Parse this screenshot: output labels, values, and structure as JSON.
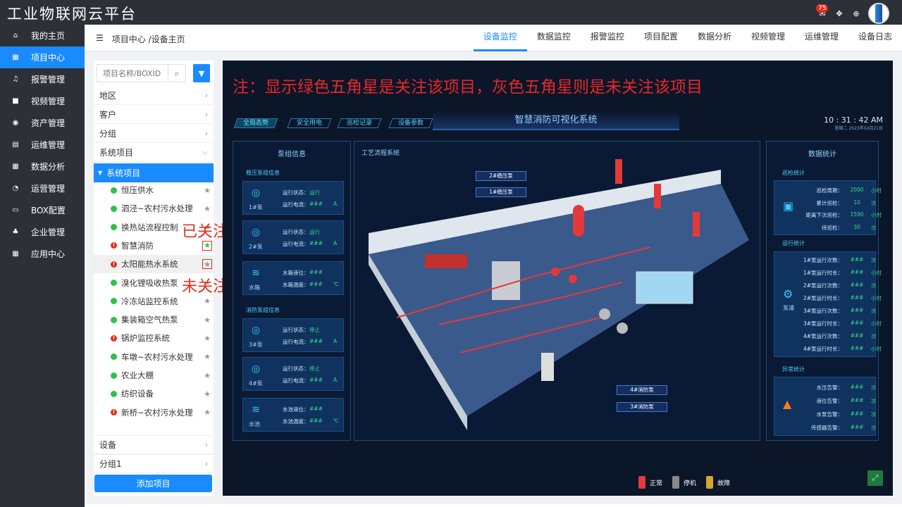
{
  "app": {
    "title": "工业物联网云平台",
    "badge": "75"
  },
  "sidebar": {
    "items": [
      {
        "label": "我的主页",
        "icon": "home-icon",
        "glyph": "⌂"
      },
      {
        "label": "项目中心",
        "icon": "grid-icon",
        "glyph": "▦"
      },
      {
        "label": "报警管理",
        "icon": "bell-icon",
        "glyph": "♫"
      },
      {
        "label": "视频管理",
        "icon": "video-icon",
        "glyph": "■"
      },
      {
        "label": "资产管理",
        "icon": "camera-icon",
        "glyph": "◉"
      },
      {
        "label": "运维管理",
        "icon": "clipboard-icon",
        "glyph": "▤"
      },
      {
        "label": "数据分析",
        "icon": "grid-icon",
        "glyph": "▦"
      },
      {
        "label": "运营管理",
        "icon": "pie-icon",
        "glyph": "◔"
      },
      {
        "label": "BOX配置",
        "icon": "monitor-icon",
        "glyph": "▭"
      },
      {
        "label": "企业管理",
        "icon": "org-icon",
        "glyph": "♣"
      },
      {
        "label": "应用中心",
        "icon": "grid-icon",
        "glyph": "▦"
      }
    ]
  },
  "header": {
    "breadcrumb": "项目中心 /设备主页",
    "tabs": [
      "设备监控",
      "数据监控",
      "报警监控",
      "项目配置",
      "数据分析",
      "视频管理",
      "运维管理",
      "设备日志"
    ]
  },
  "leftpanel": {
    "search_placeholder": "项目名称/BOXID",
    "groups": [
      "地区",
      "客户",
      "分组",
      "系统项目"
    ],
    "system_group": "系统项目",
    "projects": [
      {
        "name": "恒压供水",
        "status": "g"
      },
      {
        "name": "泗泾~农村污水处理",
        "status": "g"
      },
      {
        "name": "换热站流程控制",
        "status": "g"
      },
      {
        "name": "智慧消防",
        "status": "r"
      },
      {
        "name": "太阳能热水系统",
        "status": "r"
      },
      {
        "name": "溴化锂吸收热泵",
        "status": "g"
      },
      {
        "name": "冷冻站监控系统",
        "status": "g"
      },
      {
        "name": "集装箱空气热泵",
        "status": "g"
      },
      {
        "name": "锅炉监控系统",
        "status": "r"
      },
      {
        "name": "车墩~农村污水处理",
        "status": "g"
      },
      {
        "name": "农业大棚",
        "status": "g"
      },
      {
        "name": "纺织设备",
        "status": "g"
      },
      {
        "name": "新桥~农村污水处理",
        "status": "r"
      }
    ],
    "bottom_groups": [
      "设备",
      "分组1"
    ],
    "add_label": "添加项目"
  },
  "annotations": {
    "followed": "已关注",
    "unfollowed": "未关注"
  },
  "dashboard": {
    "note": "注：显示绿色五角星是关注该项目，灰色五角星则是未关注该项目",
    "title": "智慧消防可视化系统",
    "nav": [
      "全局态势",
      "安全用电",
      "巡检记录",
      "设备参数"
    ],
    "clock_time": "10 : 31 : 42 AM",
    "clock_date": "星期二  2023年02月21日",
    "left_title": "泵组信息",
    "sec_stable": "稳压泵组信息",
    "sec_fire": "消防泵组信息",
    "cards": [
      {
        "name": "1#泵",
        "l1": "运行状态：",
        "v1": "运行",
        "l2": "运行电流：",
        "v2": "###",
        "u2": "A"
      },
      {
        "name": "2#泵",
        "l1": "运行状态：",
        "v1": "运行",
        "l2": "运行电流：",
        "v2": "###",
        "u2": "A"
      },
      {
        "name": "水箱",
        "l1": "水箱液位：",
        "v1": "###",
        "l2": "水箱温度：",
        "v2": "###",
        "u2": "℃"
      },
      {
        "name": "3#泵",
        "l1": "运行状态：",
        "v1": "停止",
        "l2": "运行电流：",
        "v2": "###",
        "u2": "A"
      },
      {
        "name": "4#泵",
        "l1": "运行状态：",
        "v1": "停止",
        "l2": "运行电流：",
        "v2": "###",
        "u2": "A"
      },
      {
        "name": "水池",
        "l1": "水池液位：",
        "v1": "###",
        "l2": "水池温度：",
        "v2": "###",
        "u2": "℃"
      }
    ],
    "center_title": "工艺流程系统",
    "tags": [
      "2#稳压泵",
      "1#稳压泵",
      "4#消防泵",
      "3#消防泵"
    ],
    "legend": [
      "正常",
      "停机",
      "故障"
    ],
    "right_title": "数据统计",
    "inspect_title": "巡检统计",
    "inspect_rows": [
      {
        "l": "巡检周期：",
        "v": "2000",
        "u": "小时"
      },
      {
        "l": "累计巡检：",
        "v": "10",
        "u": "次"
      },
      {
        "l": "距离下次巡检：",
        "v": "1590",
        "u": "小时"
      },
      {
        "l": "待巡检：",
        "v": "30",
        "u": "次"
      }
    ],
    "run_title": "运行统计",
    "run_label": "泵浦",
    "run_rows": [
      {
        "l": "1#泵运行次数：",
        "v": "###",
        "u": "次"
      },
      {
        "l": "1#泵运行时长：",
        "v": "###",
        "u": "小时"
      },
      {
        "l": "2#泵运行次数：",
        "v": "###",
        "u": "次"
      },
      {
        "l": "2#泵运行时长：",
        "v": "###",
        "u": "小时"
      },
      {
        "l": "3#泵运行次数：",
        "v": "###",
        "u": "次"
      },
      {
        "l": "3#泵运行时长：",
        "v": "###",
        "u": "小时"
      },
      {
        "l": "4#泵运行次数：",
        "v": "###",
        "u": "次"
      },
      {
        "l": "4#泵运行时长：",
        "v": "###",
        "u": "小时"
      }
    ],
    "alarm_title": "异常统计",
    "alarm_rows": [
      {
        "l": "水压告警：",
        "v": "###",
        "u": "次"
      },
      {
        "l": "液位告警：",
        "v": "###",
        "u": "次"
      },
      {
        "l": "水泵告警：",
        "v": "###",
        "u": "次"
      },
      {
        "l": "传感器告警：",
        "v": "###",
        "u": "次"
      }
    ]
  }
}
